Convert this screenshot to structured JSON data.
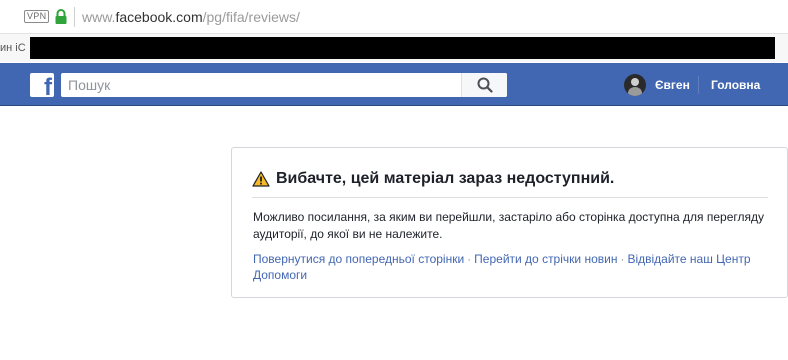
{
  "browser": {
    "vpn_label": "VPN",
    "url_prefix": "www.",
    "url_host": "facebook.com",
    "url_path": "/pg/fifa/reviews/"
  },
  "bookmarks": {
    "partial_text": "ин іС"
  },
  "header": {
    "logo_letter": "f",
    "search_placeholder": "Пошук",
    "profile_name": "Євген",
    "home_label": "Головна"
  },
  "error_card": {
    "title": "Вибачте, цей матеріал зараз недоступний.",
    "body": "Можливо посилання, за яким ви перейшли, застаріло або сторінка доступна для перегляду аудиторії, до якої ви не належите.",
    "links": {
      "back": "Повернутися до попередньої сторінки",
      "news_feed": "Перейти до стрічки новин",
      "help": "Відвідайте наш Центр Допомоги",
      "separator": "·"
    }
  },
  "colors": {
    "brand_blue": "#4267b2",
    "warning_yellow": "#f7b928",
    "lock_green": "#2ea43a"
  }
}
